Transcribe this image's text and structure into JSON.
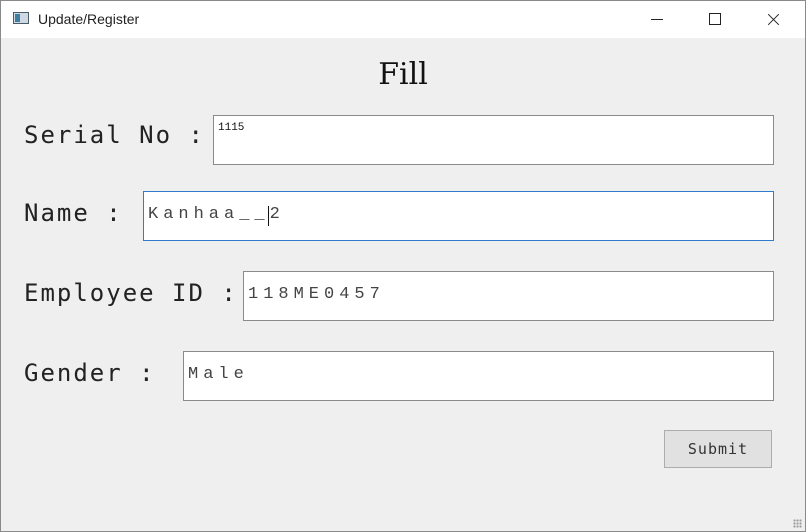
{
  "window": {
    "title": "Update/Register"
  },
  "form": {
    "heading": "Fill",
    "serial_label": "Serial No :",
    "serial_value": "1115",
    "name_label": "Name :",
    "name_value": "Kanhaa__2",
    "employee_label": "Employee ID :",
    "employee_value": "118ME0457",
    "gender_label": "Gender :",
    "gender_value": "Male",
    "submit_label": "Submit"
  },
  "colors": {
    "background": "#efefef",
    "focus_border": "#2f7ccc"
  }
}
